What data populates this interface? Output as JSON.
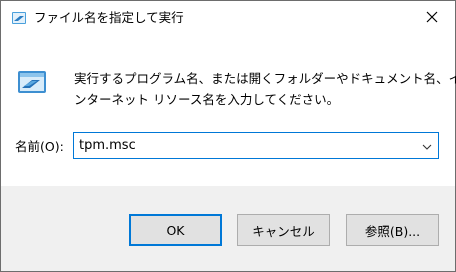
{
  "window": {
    "title": "ファイル名を指定して実行",
    "accent_color": "#0078d7",
    "footer_color": "#f0f0f0"
  },
  "titlebar": {
    "app_icon": "run-dialog-icon",
    "close_icon": "close-icon"
  },
  "main": {
    "icon": "run-program-icon",
    "description_line1": "実行するプログラム名、または開くフォルダーやドキュメント名、イ",
    "description_line2": "ンターネット リソース名を入力してください。",
    "name_label": "名前(O):",
    "input_value": "tpm.msc",
    "dropdown_icon": "chevron-down-icon"
  },
  "buttons": {
    "ok_label": "OK",
    "cancel_label": "キャンセル",
    "browse_label": "参照(B)..."
  }
}
